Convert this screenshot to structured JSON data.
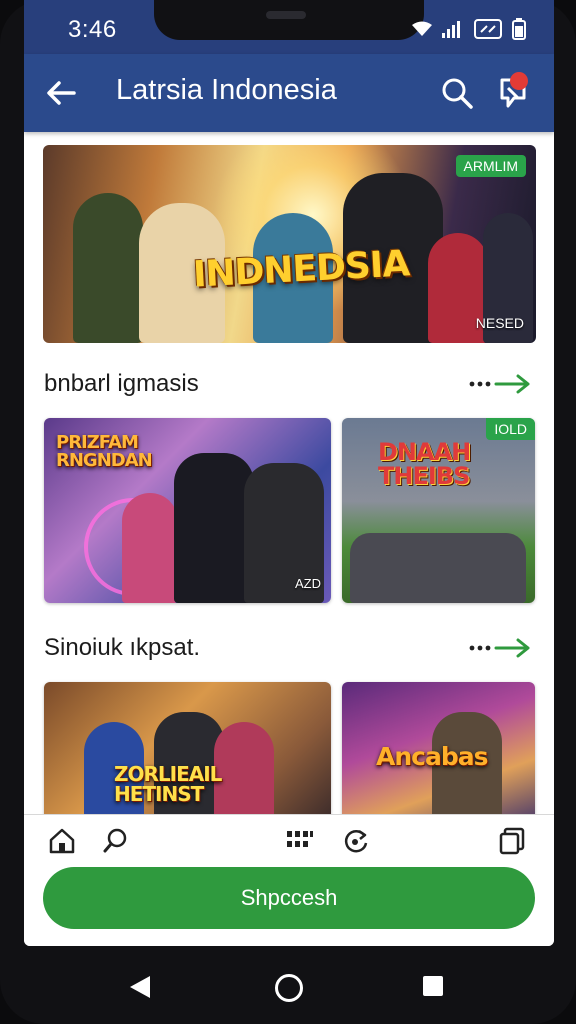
{
  "status_bar": {
    "time": "3:46"
  },
  "app_bar": {
    "title": "Latrsia Indonesia"
  },
  "hero": {
    "title": "INDNEDSIA",
    "badge": "ARMLIM",
    "label": "NESED"
  },
  "sections": [
    {
      "title": "bnbarl igmasis",
      "cards": [
        {
          "title": "PRIZFAM RNGNDAN",
          "tag": "AZD"
        },
        {
          "title": "DNAAH THEIBS",
          "badge": "IOLD"
        }
      ]
    },
    {
      "title": "Sinoiuk ıkpsat.",
      "cards": [
        {
          "title": "ZORLIEAIL HETINST"
        },
        {
          "title": "Ancabas"
        }
      ]
    }
  ],
  "cta": {
    "label": "Shpccesh"
  },
  "colors": {
    "app_bar": "#2b4a8c",
    "accent_green": "#2f9a3e",
    "notification": "#e23b36"
  },
  "icons": [
    "back-arrow-icon",
    "search-icon",
    "notification-icon",
    "home-icon",
    "search-icon",
    "grid-icon",
    "refresh-icon",
    "copy-icon"
  ]
}
